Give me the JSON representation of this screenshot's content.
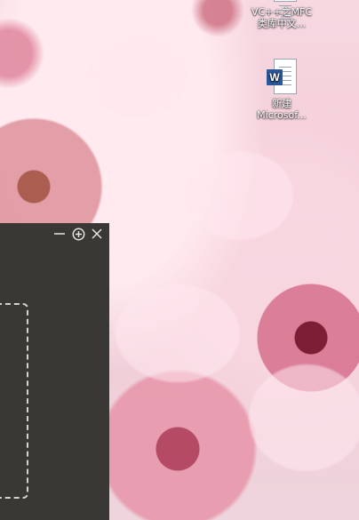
{
  "desktop": {
    "icons": [
      {
        "label_line1": "VC++之MFC",
        "label_line2": "类库中文...",
        "icon": "document-icon"
      },
      {
        "badge": "W",
        "label_line1": "新建",
        "label_line2": "Microsof...",
        "icon": "word-document-icon"
      }
    ]
  },
  "panel": {
    "controls": [
      {
        "name": "minimize-icon"
      },
      {
        "name": "zoom-in-icon"
      },
      {
        "name": "close-icon"
      }
    ]
  },
  "colors": {
    "panel_background": "#3a3834",
    "control_icon": "#e8e6e1",
    "word_blue": "#2b579a"
  }
}
